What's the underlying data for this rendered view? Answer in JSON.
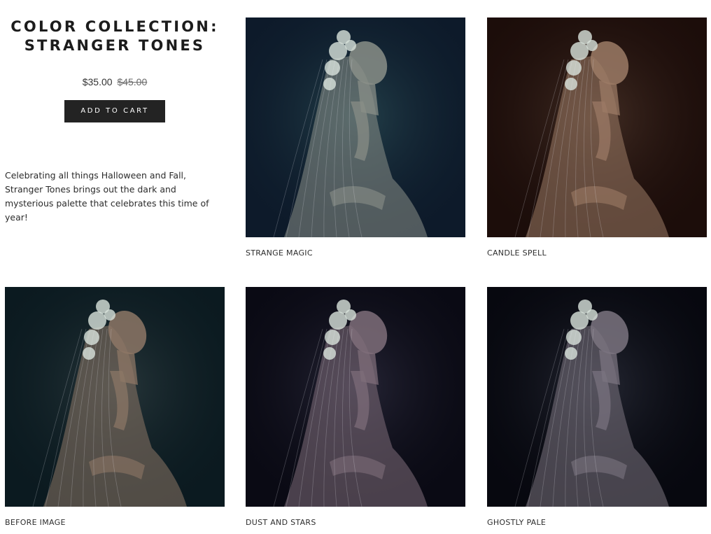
{
  "product": {
    "title_line1": "COLOR COLLECTION:",
    "title_line2": "STRANGER TONES",
    "price_sale": "$35.00",
    "price_original": "$45.00",
    "add_to_cart_label": "ADD TO CART",
    "description": "Celebrating all things Halloween and Fall, Stranger Tones brings out the dark and mysterious palette that celebrates this time of year!"
  },
  "gallery": [
    {
      "caption": "STRANGE MAGIC",
      "bg": "#0d1a2a",
      "tint": "#4f8a88",
      "skin": "#8a8f88"
    },
    {
      "caption": "CANDLE SPELL",
      "bg": "#1c0d0a",
      "tint": "#8a6a55",
      "skin": "#9c7b66"
    },
    {
      "caption": "BEFORE IMAGE",
      "bg": "#0b1a20",
      "tint": "#5f6d6d",
      "skin": "#8d7766"
    },
    {
      "caption": "DUST AND STARS",
      "bg": "#0a0a14",
      "tint": "#5d5a78",
      "skin": "#7f6e7a"
    },
    {
      "caption": "GHOSTLY PALE",
      "bg": "#07080f",
      "tint": "#5e6478",
      "skin": "#7b7480"
    }
  ]
}
